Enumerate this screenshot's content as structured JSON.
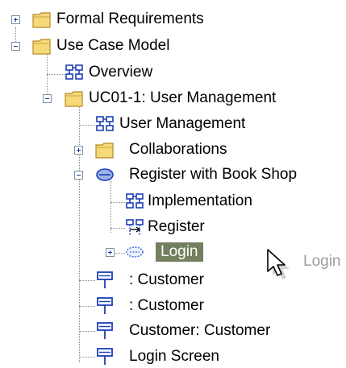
{
  "tree": {
    "items": [
      {
        "label": "Formal Requirements",
        "icon": "folder-icon",
        "expander": "plus"
      },
      {
        "label": "Use Case Model",
        "icon": "folder-icon",
        "expander": "minus"
      },
      {
        "label": "Overview",
        "icon": "diagram-icon"
      },
      {
        "label": "UC01-1: User Management",
        "icon": "folder-icon",
        "expander": "minus"
      },
      {
        "label": "User Management",
        "icon": "diagram-icon"
      },
      {
        "label": "Collaborations",
        "icon": "folder-icon",
        "expander": "plus"
      },
      {
        "label": "Register with Book Shop",
        "icon": "use-case-icon",
        "expander": "minus"
      },
      {
        "label": "Implementation",
        "icon": "diagram-icon"
      },
      {
        "label": "Register",
        "icon": "sequence-diagram-icon"
      },
      {
        "label": "Login",
        "icon": "dashed-use-case-icon",
        "expander": "plus",
        "selected": true
      },
      {
        "label": ": Customer",
        "icon": "lifeline-icon"
      },
      {
        "label": ": Customer",
        "icon": "lifeline-icon"
      },
      {
        "label": "Customer: Customer",
        "icon": "lifeline-icon"
      },
      {
        "label": "Login Screen",
        "icon": "lifeline-icon"
      }
    ]
  },
  "drag_preview": {
    "label": "Login",
    "icon": "mouse-pointer-icon"
  },
  "colors": {
    "selection": "#73805f",
    "folder": "#f5d977",
    "diagram": "#1c3fb4"
  }
}
